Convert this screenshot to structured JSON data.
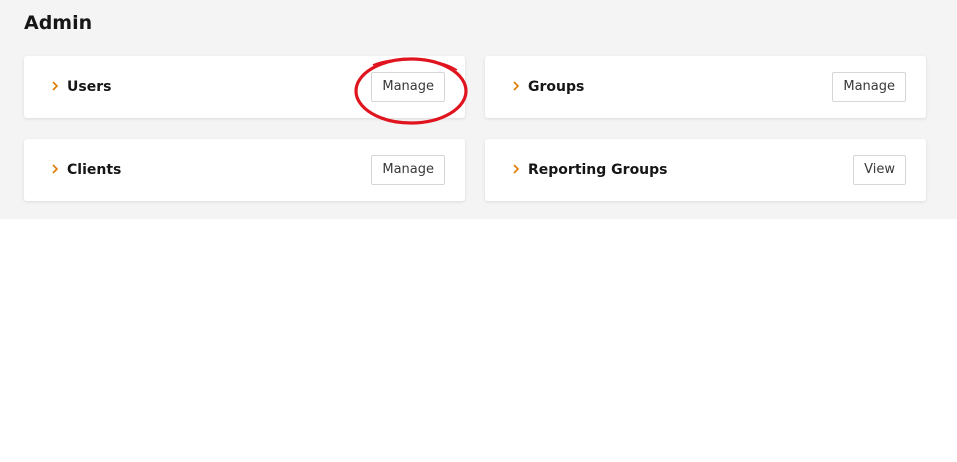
{
  "page": {
    "title": "Admin"
  },
  "cards": [
    {
      "label": "Users",
      "action": "Manage"
    },
    {
      "label": "Groups",
      "action": "Manage"
    },
    {
      "label": "Clients",
      "action": "Manage"
    },
    {
      "label": "Reporting Groups",
      "action": "View"
    }
  ],
  "colors": {
    "chevron": "#e07b00",
    "annotation": "#e0141e",
    "panel_background": "#f4f4f4"
  },
  "icons": {
    "card_expand": "chevron-right-icon"
  }
}
